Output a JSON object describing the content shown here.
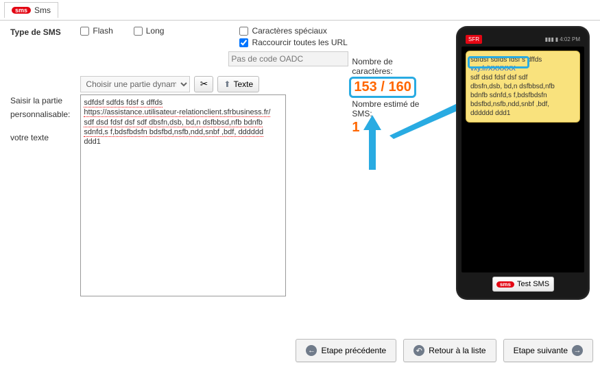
{
  "tab": {
    "label": "Sms"
  },
  "labels": {
    "type_title": "Type de SMS",
    "partie_perso1": "Saisir la partie",
    "partie_perso2": "personnalisable:",
    "votre_texte": "votre texte"
  },
  "checks": {
    "flash": "Flash",
    "long": "Long",
    "special": "Caractères spéciaux",
    "shorten": "Raccourcir toutes les URL"
  },
  "oadc": {
    "placeholder": "Pas de code OADC"
  },
  "dyn": {
    "select_label": "Choisir une partie dynamique",
    "text_btn": "Texte"
  },
  "textarea_lines": {
    "l1": "sdfdsf sdfds fdsf s dffds",
    "l2": "https://assistance.utilisateur-relationclient.sfrbusiness.fr/",
    "l3": "sdf dsd fdsf dsf sdf dbsfn,dsb, bd,n dsfbbsd,nfb bdnfb",
    "l4": "sdnfd,s f,bdsfbdsfn bdsfbd,nsfb,ndd,snbf ,bdf, dddddd",
    "l5": "ddd1"
  },
  "counter": {
    "chars_label": "Nombre de caractères:",
    "chars_value": "153 / 160",
    "est_label": "Nombre estimé de SMS:",
    "est_value": "1"
  },
  "phone": {
    "operator": "SFR",
    "time": "4:02 PM",
    "msg_l1": "sdfdsf sdfds fdsf s dffds",
    "short_url": "vxy.fr/XXXXXX",
    "msg_l2": "sdf dsd fdsf dsf sdf",
    "msg_l3": "dbsfn,dsb, bd,n dsfbbsd,nfb",
    "msg_l4": "bdnfb sdnfd,s f,bdsfbdsfn",
    "msg_l5": "bdsfbd,nsfb,ndd,snbf ,bdf,",
    "msg_l6": "dddddd ddd1",
    "test_btn": "Test SMS"
  },
  "buttons": {
    "prev": "Etape précédente",
    "list": "Retour à la liste",
    "next": "Etape suivante"
  }
}
